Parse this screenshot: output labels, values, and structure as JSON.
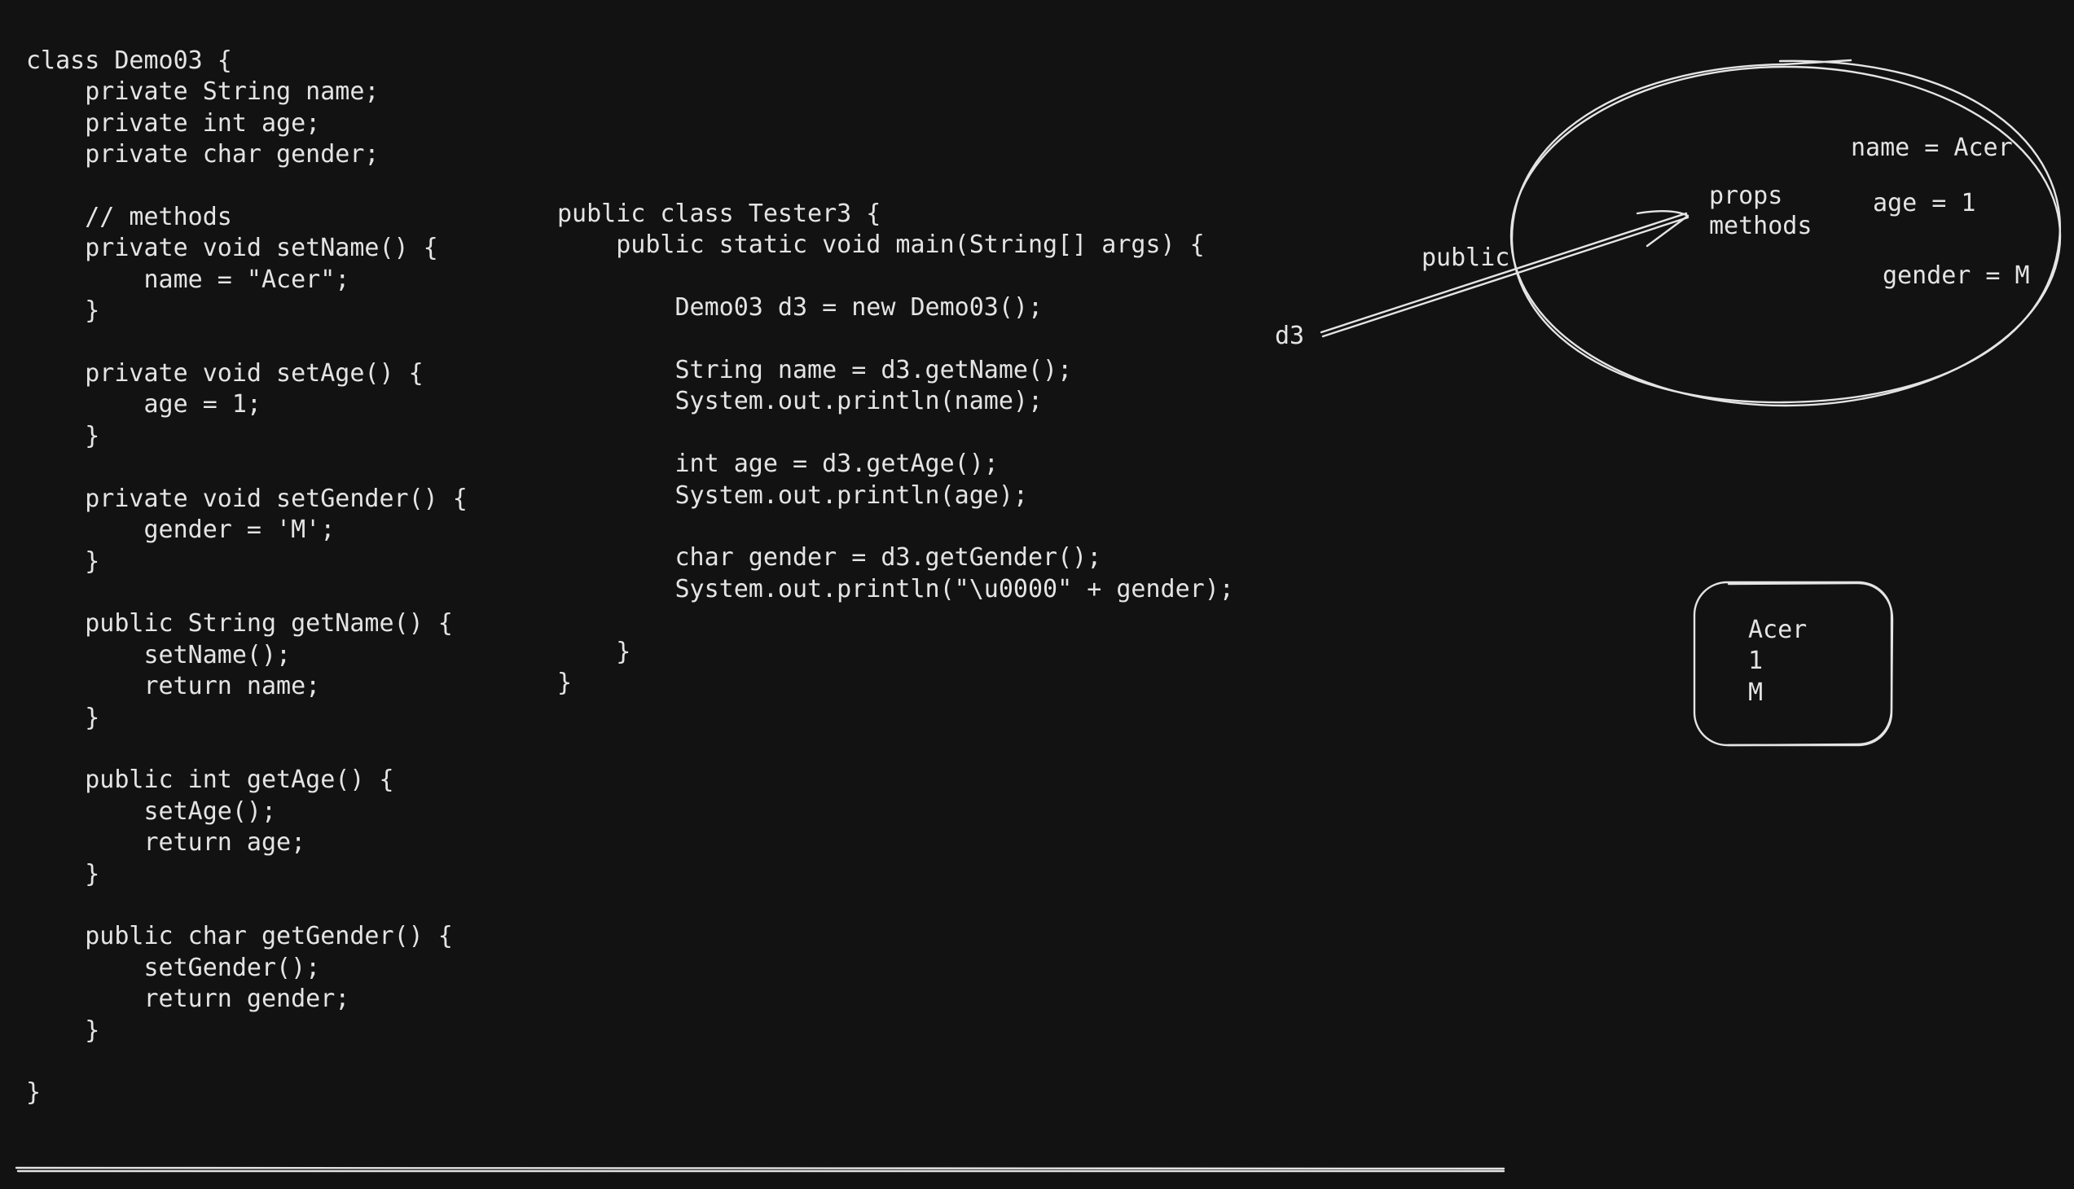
{
  "code": {
    "demo03": [
      "class Demo03 {",
      "    private String name;",
      "    private int age;",
      "    private char gender;",
      "",
      "    // methods",
      "    private void setName() {",
      "        name = \"Acer\";",
      "    }",
      "",
      "    private void setAge() {",
      "        age = 1;",
      "    }",
      "",
      "    private void setGender() {",
      "        gender = 'M';",
      "    }",
      "",
      "    public String getName() {",
      "        setName();",
      "        return name;",
      "    }",
      "",
      "    public int getAge() {",
      "        setAge();",
      "        return age;",
      "    }",
      "",
      "    public char getGender() {",
      "        setGender();",
      "        return gender;",
      "    }",
      "",
      "}"
    ],
    "tester3": [
      "public class Tester3 {",
      "    public static void main(String[] args) {",
      "",
      "        Demo03 d3 = new Demo03();",
      "",
      "        String name = d3.getName();",
      "        System.out.println(name);",
      "",
      "        int age = d3.getAge();",
      "        System.out.println(age);",
      "",
      "        char gender = d3.getGender();",
      "        System.out.println(\"\\u0000\" + gender);",
      "",
      "    }",
      "}"
    ]
  },
  "diagram": {
    "reference_label": "d3",
    "access_label": "public",
    "object": {
      "props_label": "props",
      "methods_label": "methods",
      "name_value": "name = Acer",
      "age_value": "age = 1",
      "gender_value": "gender = M"
    },
    "output": [
      "Acer",
      "1",
      "M"
    ]
  }
}
